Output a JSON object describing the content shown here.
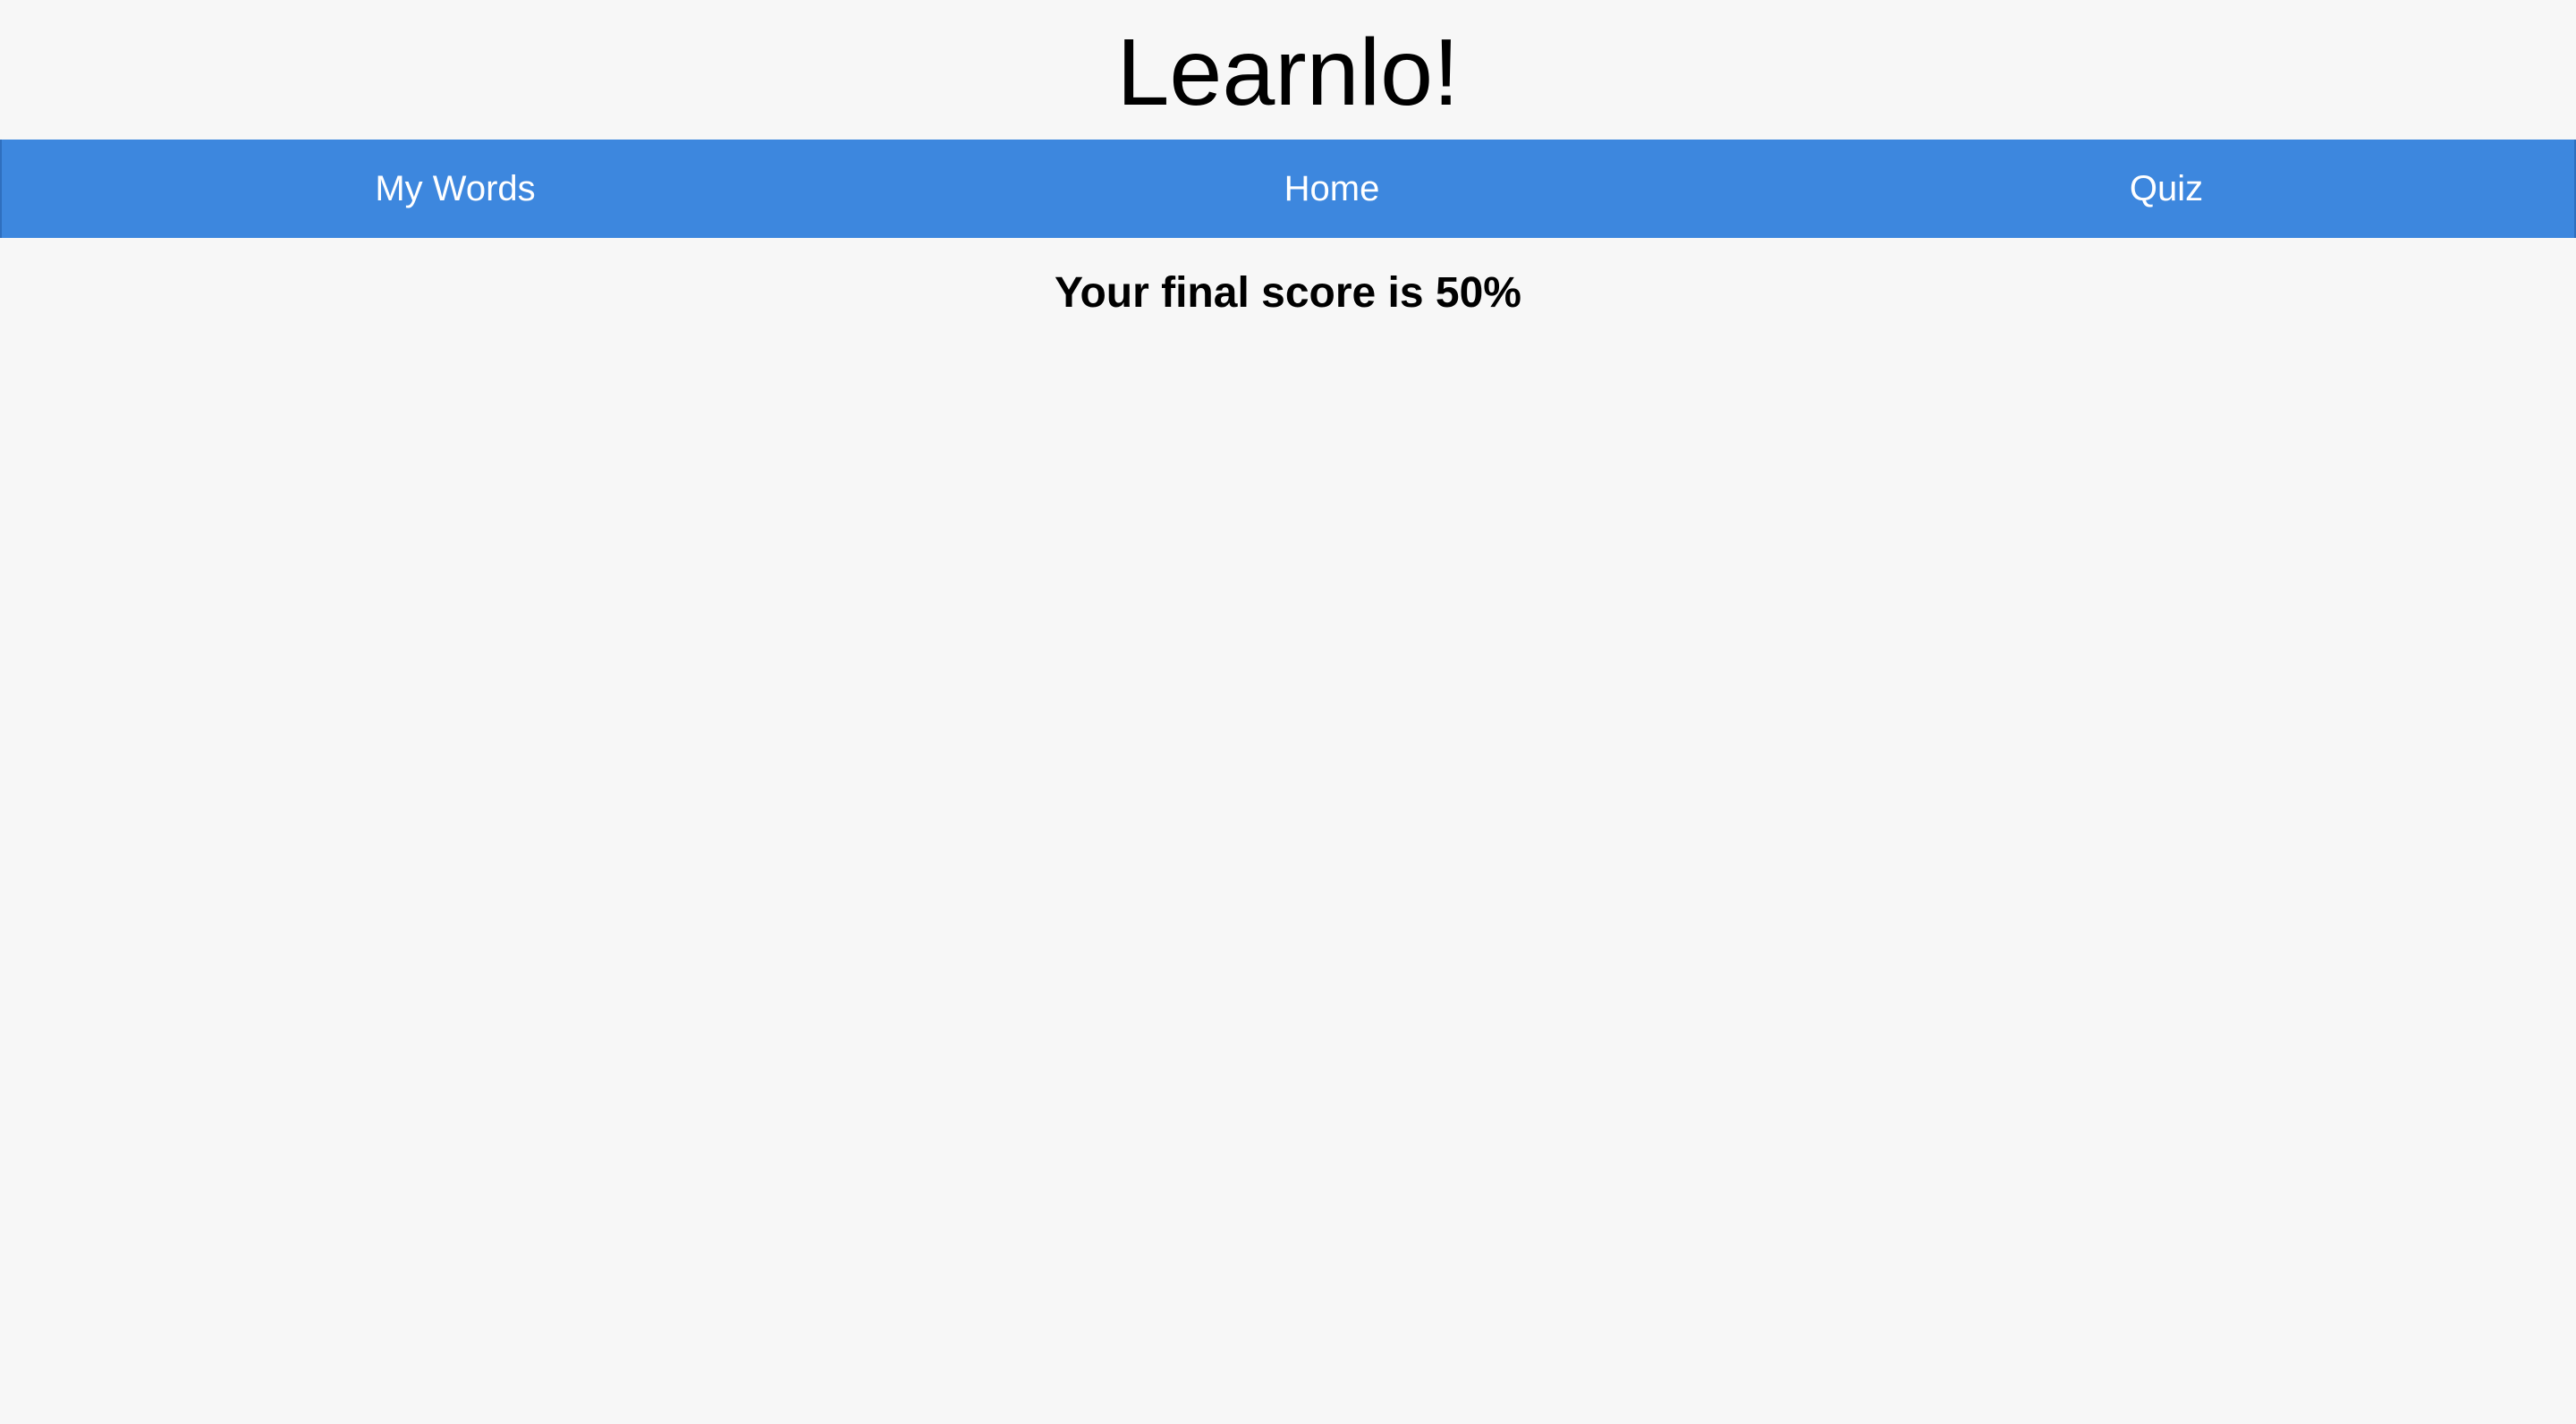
{
  "header": {
    "title": "Learnlo!"
  },
  "nav": {
    "items": [
      {
        "label": "My Words"
      },
      {
        "label": "Home"
      },
      {
        "label": "Quiz"
      }
    ],
    "background_color": "#3d87de",
    "text_color": "#ffffff"
  },
  "main": {
    "score_text": "Your final score is 50%",
    "score_percent": 50
  },
  "colors": {
    "page_background": "#f7f7f7",
    "text": "#000000"
  }
}
